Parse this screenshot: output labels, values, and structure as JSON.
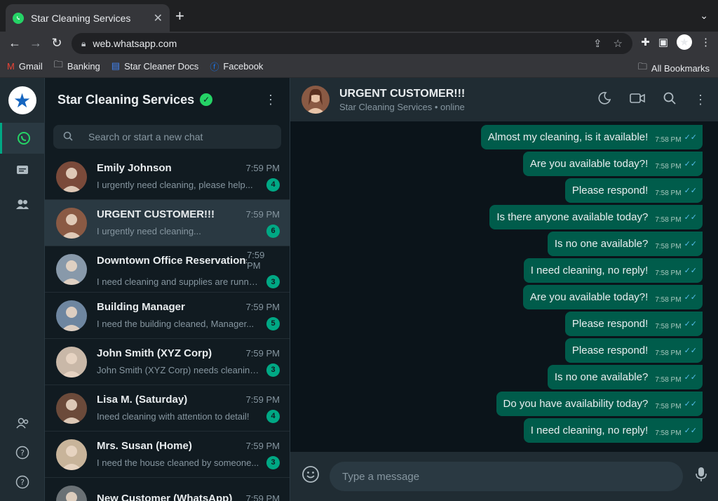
{
  "browser": {
    "tab_title": "Star Cleaning Services",
    "url": "web.whatsapp.com",
    "bookmarks": [
      {
        "label": "Gmail",
        "icon": "gmail-icon"
      },
      {
        "label": "Banking",
        "icon": "folder-icon"
      },
      {
        "label": "Star Cleaner Docs",
        "icon": "docs-icon"
      },
      {
        "label": "Facebook",
        "icon": "facebook-icon"
      }
    ],
    "all_bookmarks": "All Bookmarks"
  },
  "sidebar": {
    "account_name": "Star Cleaning Services",
    "search_placeholder": "Search or start a new chat",
    "chats": [
      {
        "name": "Emily Johnson",
        "time": "7:59 PM",
        "preview": "I urgently need cleaning, please help...",
        "unread": "4",
        "avatar_color": "#7a4a3a"
      },
      {
        "name": "URGENT CUSTOMER!!!",
        "time": "7:59 PM",
        "preview": "I urgently need cleaning...",
        "unread": "6",
        "avatar_color": "#8a5a44"
      },
      {
        "name": "Downtown Office Reservations",
        "time": "7:59 PM",
        "preview": "I need cleaning and supplies are running low...",
        "unread": "3",
        "avatar_color": "#8899aa"
      },
      {
        "name": "Building Manager",
        "time": "7:59 PM",
        "preview": "I need the building cleaned, Manager...",
        "unread": "5",
        "avatar_color": "#6e86a0"
      },
      {
        "name": "John Smith (XYZ Corp)",
        "time": "7:59 PM",
        "preview": "John Smith (XYZ Corp) needs cleaning...",
        "unread": "3",
        "avatar_color": "#c9b8a8"
      },
      {
        "name": "Lisa M. (Saturday)",
        "time": "7:59 PM",
        "preview": "Ineed cleaning with attention to detail!",
        "unread": "4",
        "avatar_color": "#6b4a3a"
      },
      {
        "name": "Mrs. Susan (Home)",
        "time": "7:59 PM",
        "preview": "I need the house cleaned by someone...",
        "unread": "3",
        "avatar_color": "#c8b49a"
      },
      {
        "name": "New Customer (WhatsApp)",
        "time": "7:59 PM",
        "preview": "",
        "unread": "",
        "avatar_color": "#6a7175"
      }
    ]
  },
  "conversation": {
    "name": "URGENT CUSTOMER!!!",
    "status": "Star Cleaning Services • online",
    "messages": [
      {
        "text": "Almost my cleaning, is it available!",
        "time": "7:58 PM"
      },
      {
        "text": "Are you available today?!",
        "time": "7:58 PM"
      },
      {
        "text": "Please respond!",
        "time": "7:58 PM"
      },
      {
        "text": "Is there anyone available today?",
        "time": "7:58 PM"
      },
      {
        "text": "Is no one available?",
        "time": "7:58 PM"
      },
      {
        "text": "I need cleaning, no reply!",
        "time": "7:58 PM"
      },
      {
        "text": "Are you available today?!",
        "time": "7:58 PM"
      },
      {
        "text": "Please respond!",
        "time": "7:58 PM"
      },
      {
        "text": "Please respond!",
        "time": "7:58 PM"
      },
      {
        "text": "Is no one available?",
        "time": "7:58 PM"
      },
      {
        "text": "Do you have availability today?",
        "time": "7:58 PM"
      },
      {
        "text": "I need cleaning, no reply!",
        "time": "7:58 PM"
      }
    ],
    "composer_placeholder": "Type a message"
  },
  "colors": {
    "accent": "#00a884",
    "bubble": "#005c4b",
    "read_tick": "#53bdeb"
  }
}
